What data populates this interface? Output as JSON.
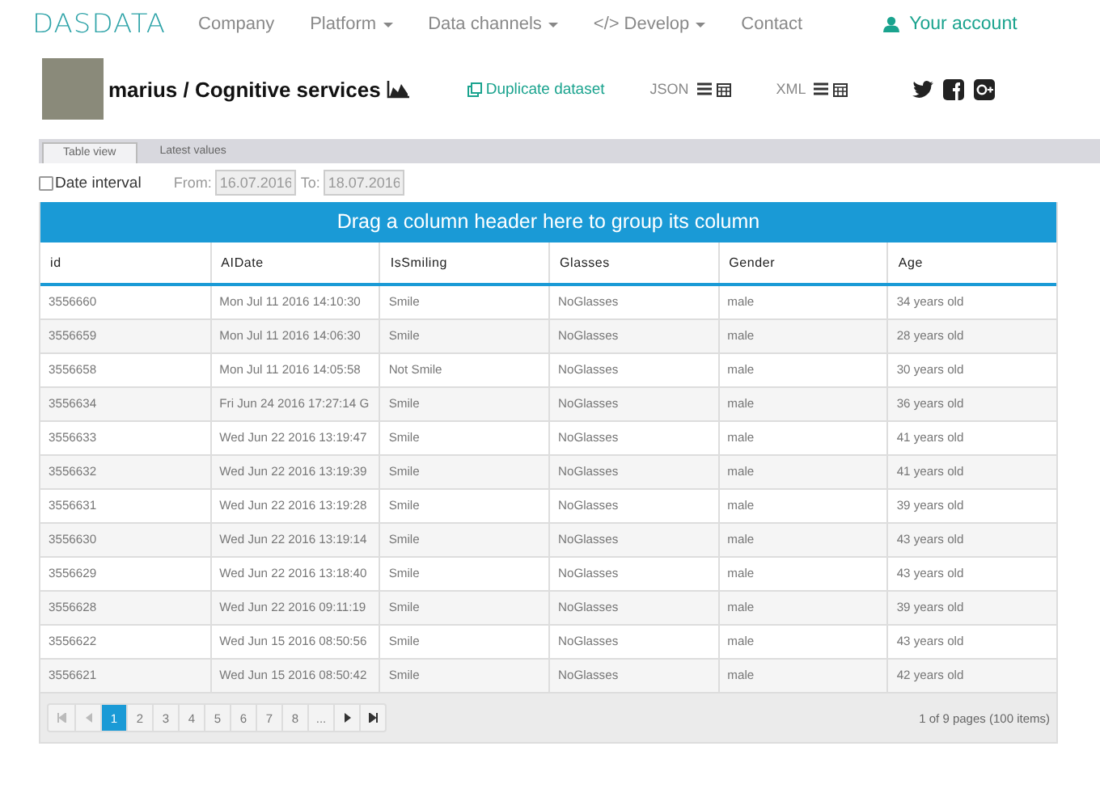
{
  "nav": {
    "logo": "DASDATA",
    "items": [
      {
        "label": "Company",
        "dropdown": false
      },
      {
        "label": "Platform",
        "dropdown": true
      },
      {
        "label": "Data channels",
        "dropdown": true
      },
      {
        "label": "Develop",
        "dropdown": true,
        "prefix": "</>"
      },
      {
        "label": "Contact",
        "dropdown": false
      }
    ],
    "account": "Your account"
  },
  "header": {
    "title": "marius / Cognitive services",
    "duplicate": "Duplicate dataset",
    "exports": [
      "JSON",
      "XML"
    ]
  },
  "tabs": [
    {
      "label": "Table view",
      "selected": true
    },
    {
      "label": "Latest values",
      "selected": false
    }
  ],
  "filter": {
    "label": "Date interval",
    "checked": false,
    "from_label": "From:",
    "from": "16.07.2016",
    "to_label": "To:",
    "to": "18.07.2016"
  },
  "table": {
    "group_hint": "Drag a column header here to group its column",
    "columns": [
      "id",
      "AIDate",
      "IsSmiling",
      "Glasses",
      "Gender",
      "Age"
    ],
    "rows": [
      [
        "3556660",
        "Mon Jul 11 2016 14:10:30",
        "Smile",
        "NoGlasses",
        "male",
        "34 years old"
      ],
      [
        "3556659",
        "Mon Jul 11 2016 14:06:30",
        "Smile",
        "NoGlasses",
        "male",
        "28 years old"
      ],
      [
        "3556658",
        "Mon Jul 11 2016 14:05:58",
        "Not Smile",
        "NoGlasses",
        "male",
        "30 years old"
      ],
      [
        "3556634",
        "Fri Jun 24 2016 17:27:14 G",
        "Smile",
        "NoGlasses",
        "male",
        "36 years old"
      ],
      [
        "3556633",
        "Wed Jun 22 2016 13:19:47",
        "Smile",
        "NoGlasses",
        "male",
        "41 years old"
      ],
      [
        "3556632",
        "Wed Jun 22 2016 13:19:39",
        "Smile",
        "NoGlasses",
        "male",
        "41 years old"
      ],
      [
        "3556631",
        "Wed Jun 22 2016 13:19:28",
        "Smile",
        "NoGlasses",
        "male",
        "39 years old"
      ],
      [
        "3556630",
        "Wed Jun 22 2016 13:19:14",
        "Smile",
        "NoGlasses",
        "male",
        "43 years old"
      ],
      [
        "3556629",
        "Wed Jun 22 2016 13:18:40",
        "Smile",
        "NoGlasses",
        "male",
        "43 years old"
      ],
      [
        "3556628",
        "Wed Jun 22 2016 09:11:19",
        "Smile",
        "NoGlasses",
        "male",
        "39 years old"
      ],
      [
        "3556622",
        "Wed Jun 15 2016 08:50:56",
        "Smile",
        "NoGlasses",
        "male",
        "43 years old"
      ],
      [
        "3556621",
        "Wed Jun 15 2016 08:50:42",
        "Smile",
        "NoGlasses",
        "male",
        "42 years old"
      ]
    ]
  },
  "pager": {
    "first_disabled": true,
    "prev_disabled": true,
    "pages": [
      {
        "label": "1",
        "selected": true
      },
      {
        "label": "2",
        "selected": false
      },
      {
        "label": "3",
        "selected": false
      },
      {
        "label": "4",
        "selected": false
      },
      {
        "label": "5",
        "selected": false
      },
      {
        "label": "6",
        "selected": false
      },
      {
        "label": "7",
        "selected": false
      },
      {
        "label": "8",
        "selected": false
      },
      {
        "label": "...",
        "selected": false
      }
    ],
    "info": "1 of 9 pages (100 items)"
  }
}
